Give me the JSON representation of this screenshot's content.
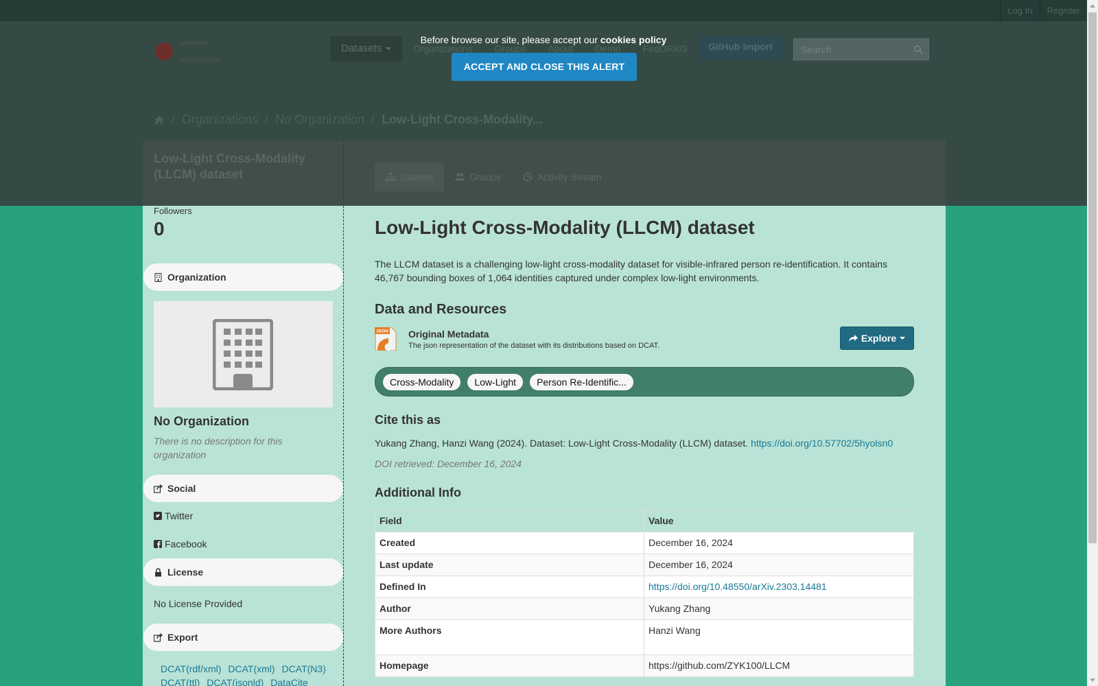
{
  "account": {
    "login": "Log In",
    "register": "Register"
  },
  "nav": {
    "datasets": "Datasets",
    "organizations": "Organizations",
    "groups": "Groups",
    "about": "About",
    "demo": "Demo",
    "fedorkg": "FedORKG",
    "github_import": "GitHub Import",
    "search_placeholder": "Search"
  },
  "cookie_alert": {
    "text": "Before browse our site, please accept our ",
    "policy": "cookies policy",
    "button": "ACCEPT AND CLOSE THIS ALERT"
  },
  "breadcrumb": {
    "organizations": "Organizations",
    "no_org": "No Organization",
    "current": "Low-Light Cross-Modality..."
  },
  "sidebar": {
    "title": "Low-Light Cross-Modality (LLCM) dataset",
    "followers_label": "Followers",
    "followers_count": "0",
    "organization_heading": "Organization",
    "org_name": "No Organization",
    "org_desc": "There is no description for this organization",
    "social_heading": "Social",
    "twitter": "Twitter",
    "facebook": "Facebook",
    "license_heading": "License",
    "license_text": "No License Provided",
    "export_heading": "Export",
    "export_links": [
      "DCAT(rdf/xml)",
      "DCAT(xml)",
      "DCAT(N3)",
      "DCAT(ttl)",
      "DCAT(jsonld)",
      "DataCite"
    ]
  },
  "tabs": {
    "dataset": "Dataset",
    "groups": "Groups",
    "activity": "Activity Stream"
  },
  "main": {
    "title": "Low-Light Cross-Modality (LLCM) dataset",
    "notes": "The LLCM dataset is a challenging low-light cross-modality dataset for visible-infrared person re-identification. It contains 46,767 bounding boxes of 1,064 identities captured under complex low-light environments.",
    "resources_heading": "Data and Resources",
    "resource_format": "JSON",
    "resource_title": "Original Metadata",
    "resource_desc": "The json representation of the dataset with its distributions based on DCAT.",
    "explore": "Explore",
    "tags": [
      "Cross-Modality",
      "Low-Light",
      "Person Re-Identific..."
    ],
    "cite_heading": "Cite this as",
    "cite_text": "Yukang Zhang, Hanzi Wang (2024). Dataset: Low-Light Cross-Modality (LLCM) dataset. ",
    "cite_doi": "https://doi.org/10.57702/5hyolsn0",
    "doi_retrieved": "DOI retrieved: December 16, 2024",
    "additional_heading": "Additional Info",
    "table_header": {
      "field": "Field",
      "value": "Value"
    },
    "table_rows": [
      {
        "field": "Created",
        "value": "December 16, 2024"
      },
      {
        "field": "Last update",
        "value": "December 16, 2024"
      },
      {
        "field": "Defined In",
        "value": "https://doi.org/10.48550/arXiv.2303.14481"
      },
      {
        "field": "Author",
        "value": "Yukang Zhang"
      },
      {
        "field": "More Authors",
        "value": "Hanzi Wang"
      },
      {
        "field": "Homepage",
        "value": "https://github.com/ZYK100/LLCM"
      }
    ]
  }
}
